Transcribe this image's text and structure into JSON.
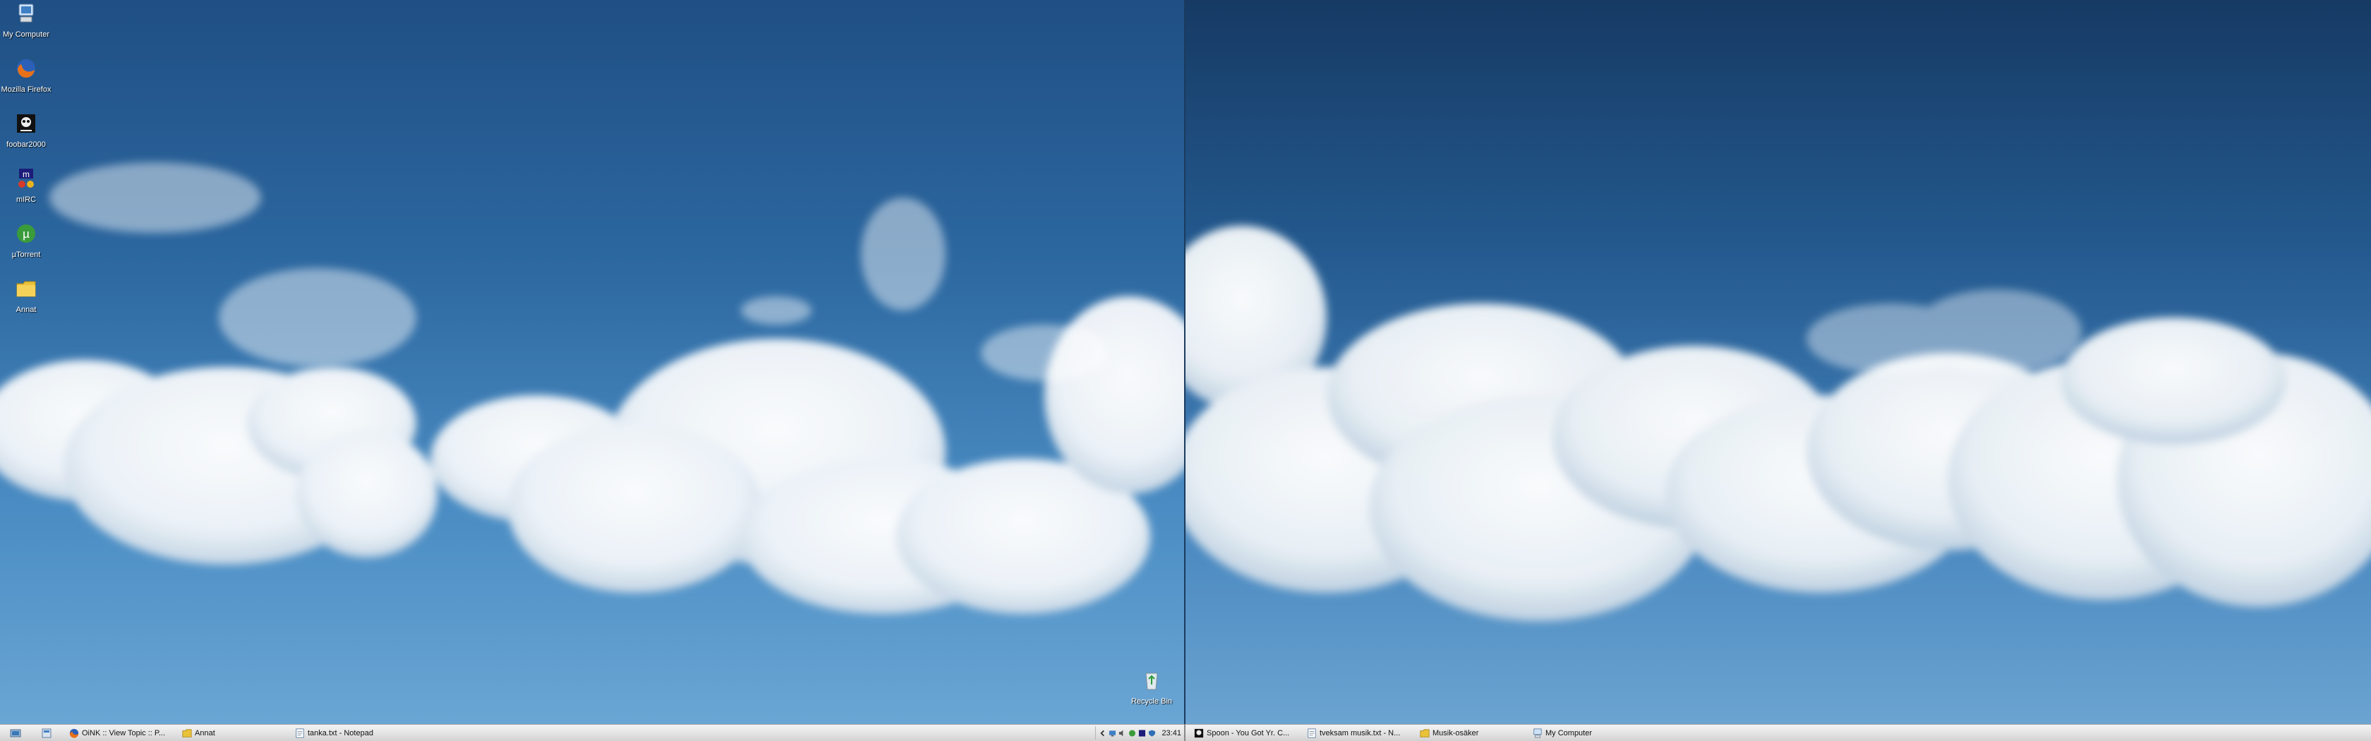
{
  "desktop_icons": [
    {
      "label": "My Computer",
      "icon": "computer-icon"
    },
    {
      "label": "Mozilla Firefox",
      "icon": "firefox-icon"
    },
    {
      "label": "foobar2000",
      "icon": "foobar-icon"
    },
    {
      "label": "mIRC",
      "icon": "mirc-icon"
    },
    {
      "label": "µTorrent",
      "icon": "utorrent-icon"
    },
    {
      "label": "Annat",
      "icon": "folder-icon"
    }
  ],
  "recycle_bin": {
    "label": "Recycle Bin",
    "icon": "recycle-bin-icon"
  },
  "taskbar_left": {
    "quick_launch": [
      "show-desktop-icon",
      "explorer-icon"
    ],
    "tasks": [
      {
        "label": "OiNK :: View Topic :: P...",
        "icon": "firefox-icon"
      },
      {
        "label": "Annat",
        "icon": "folder-icon"
      },
      {
        "label": "tanka.txt - Notepad",
        "icon": "notepad-icon"
      }
    ],
    "tray_icons": [
      "arrow-icon",
      "network-icon",
      "volume-icon",
      "utorrent-tray-icon",
      "mirc-tray-icon",
      "security-icon"
    ],
    "clock": "23:41"
  },
  "taskbar_right": {
    "tasks": [
      {
        "label": "Spoon - You Got Yr. C...",
        "icon": "foobar-icon"
      },
      {
        "label": "tveksam musik.txt - N...",
        "icon": "notepad-icon"
      },
      {
        "label": "Musik-osäker",
        "icon": "folder-icon"
      },
      {
        "label": "My Computer",
        "icon": "computer-icon"
      }
    ]
  },
  "colors": {
    "sky_top": "#1f4f84",
    "sky_bottom": "#6aa6d4",
    "taskbar": "#e3e3e3"
  }
}
